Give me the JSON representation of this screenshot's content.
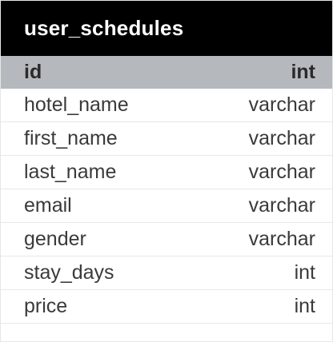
{
  "table": {
    "name": "user_schedules",
    "primary_key": {
      "name": "id",
      "type": "int"
    },
    "columns": [
      {
        "name": "hotel_name",
        "type": "varchar"
      },
      {
        "name": "first_name",
        "type": "varchar"
      },
      {
        "name": "last_name",
        "type": "varchar"
      },
      {
        "name": "email",
        "type": "varchar"
      },
      {
        "name": "gender",
        "type": "varchar"
      },
      {
        "name": "stay_days",
        "type": "int"
      },
      {
        "name": "price",
        "type": "int"
      }
    ]
  },
  "colors": {
    "header_background": "#000000",
    "header_text": "#ffffff",
    "primary_key_row_background": "#b5b9be",
    "row_text": "#3a3a3a"
  }
}
